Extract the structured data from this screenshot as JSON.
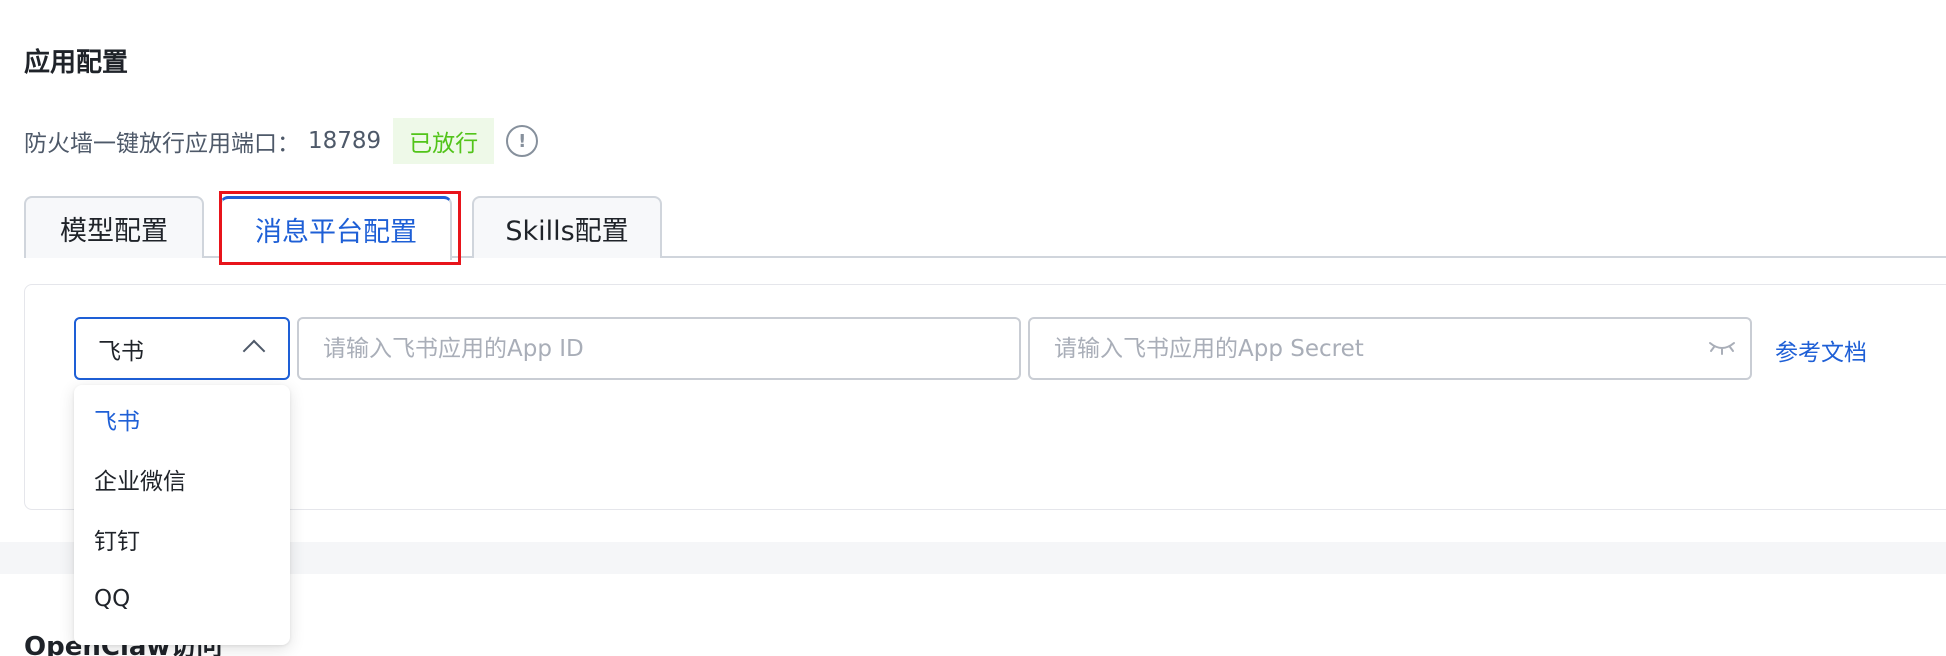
{
  "app_config": {
    "title": "应用配置",
    "firewall_label": "防火墙一键放行应用端口：",
    "firewall_port": "18789",
    "firewall_status": "已放行",
    "info_glyph": "!"
  },
  "tabs": [
    {
      "label": "模型配置"
    },
    {
      "label": "消息平台配置",
      "active": true
    },
    {
      "label": "Skills配置"
    }
  ],
  "platform": {
    "selected": "飞书",
    "options": [
      "飞书",
      "企业微信",
      "钉钉",
      "QQ"
    ]
  },
  "inputs": {
    "app_id_placeholder": "请输入飞书应用的App ID",
    "app_secret_placeholder": "请输入飞书应用的App Secret"
  },
  "doc_link": "参考文档",
  "next_section_title": "OpenClaw访问",
  "colors": {
    "accent": "#1e5fd6",
    "success": "#52c41a",
    "highlight": "#e8141b"
  },
  "icons": [
    "info-icon",
    "chevron-up-icon",
    "eye-closed-icon"
  ]
}
